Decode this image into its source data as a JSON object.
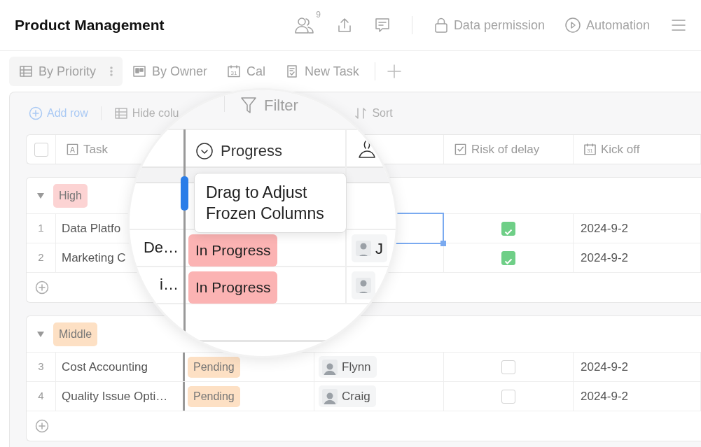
{
  "header": {
    "title": "Product Management",
    "collaborator_count": "9",
    "actions": [
      {
        "label": "Data permission"
      },
      {
        "label": "Automation"
      }
    ]
  },
  "views": [
    {
      "label": "By Priority",
      "selected": true
    },
    {
      "label": "By Owner",
      "selected": false
    },
    {
      "label": "Cal",
      "icon_text": "31",
      "selected": false
    },
    {
      "label": "New Task",
      "selected": false
    }
  ],
  "toolbar": [
    {
      "label": "Add row",
      "kind": "accent"
    },
    {
      "label": "Hide colu",
      "kind": "plain"
    },
    {
      "label": "Sort",
      "kind": "plain"
    }
  ],
  "select_all": {
    "checked": false
  },
  "columns": [
    {
      "label": "Task",
      "icon_text": "A"
    },
    {
      "label": "Risk of delay"
    },
    {
      "label": "Kick off",
      "icon_text": "31"
    }
  ],
  "groups": [
    {
      "label": "High",
      "color": "#fcd3d3",
      "expanded": true,
      "rows": [
        {
          "number": "1",
          "task": "Data Platfo",
          "risk": true,
          "kick_off": "2024-9-2"
        },
        {
          "number": "2",
          "task": "Marketing C",
          "risk": true,
          "kick_off": "2024-9-2"
        }
      ]
    },
    {
      "label": "Middle",
      "color": "#fde0c4",
      "expanded": true,
      "rows": [
        {
          "number": "3",
          "task": "Cost Accounting",
          "progress": "Pending",
          "color": "#fde0c4",
          "owner": "Flynn",
          "risk": false,
          "kick_off": "2024-9-2"
        },
        {
          "number": "4",
          "task": "Quality Issue Opti…",
          "progress": "Pending",
          "color": "#fde0c4",
          "owner": "Craig",
          "risk": false,
          "kick_off": "2024-9-2"
        }
      ]
    }
  ],
  "magnifier": {
    "toolbar_label": "Filter",
    "column": "Progress",
    "tooltip": "Drag to Adjust Frozen Columns",
    "rows": [
      {
        "task": "De…",
        "progress": "In Progress",
        "color": "#fbb3b3",
        "owner": "J"
      },
      {
        "task": "i…",
        "progress": "In Progress",
        "color": "#fbb3b3"
      }
    ]
  }
}
